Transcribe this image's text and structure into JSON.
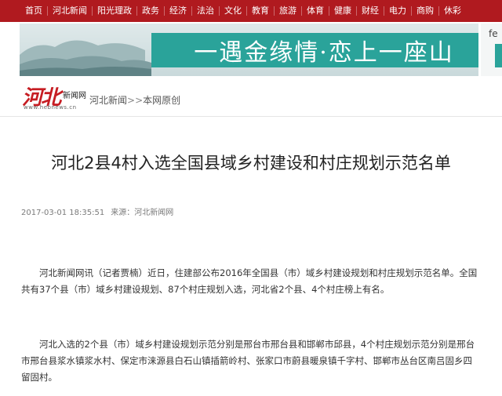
{
  "topnav": {
    "items": [
      "首页",
      "河北新闻",
      "阳光理政",
      "政务",
      "经济",
      "法治",
      "文化",
      "教育",
      "旅游",
      "体育",
      "健康",
      "财经",
      "电力",
      "商购",
      "休彩"
    ]
  },
  "banner": {
    "slogan": "一遇金缘情·恋上一座山",
    "side_label": "fe",
    "accent_color": "#2aa39a"
  },
  "site": {
    "logo_text": "河北",
    "logo_subtext": "新闻网",
    "logo_domain": "www.hebnews.cn",
    "brand_color": "#b01a1f"
  },
  "breadcrumb": {
    "home": "河北新闻",
    "separator": ">>",
    "current": "本网原创"
  },
  "article": {
    "title": "河北2县4村入选全国县域乡村建设和村庄规划示范名单",
    "timestamp": "2017-03-01 18:35:51",
    "source": "来源：河北新闻网",
    "paragraphs": [
      "河北新闻网讯（记者贾楠）近日，住建部公布2016年全国县（市）域乡村建设规划和村庄规划示范名单。全国共有37个县（市）域乡村建设规划、87个村庄规划入选，河北省2个县、4个村庄榜上有名。",
      "河北入选的2个县（市）域乡村建设规划示范分别是邢台市邢台县和邯郸市邱县，4个村庄规划示范分别是邢台市邢台县浆水镇浆水村、保定市涞源县白石山镇插箭岭村、张家口市蔚县暖泉镇千字村、邯郸市丛台区南吕固乡四留固村。"
    ]
  }
}
